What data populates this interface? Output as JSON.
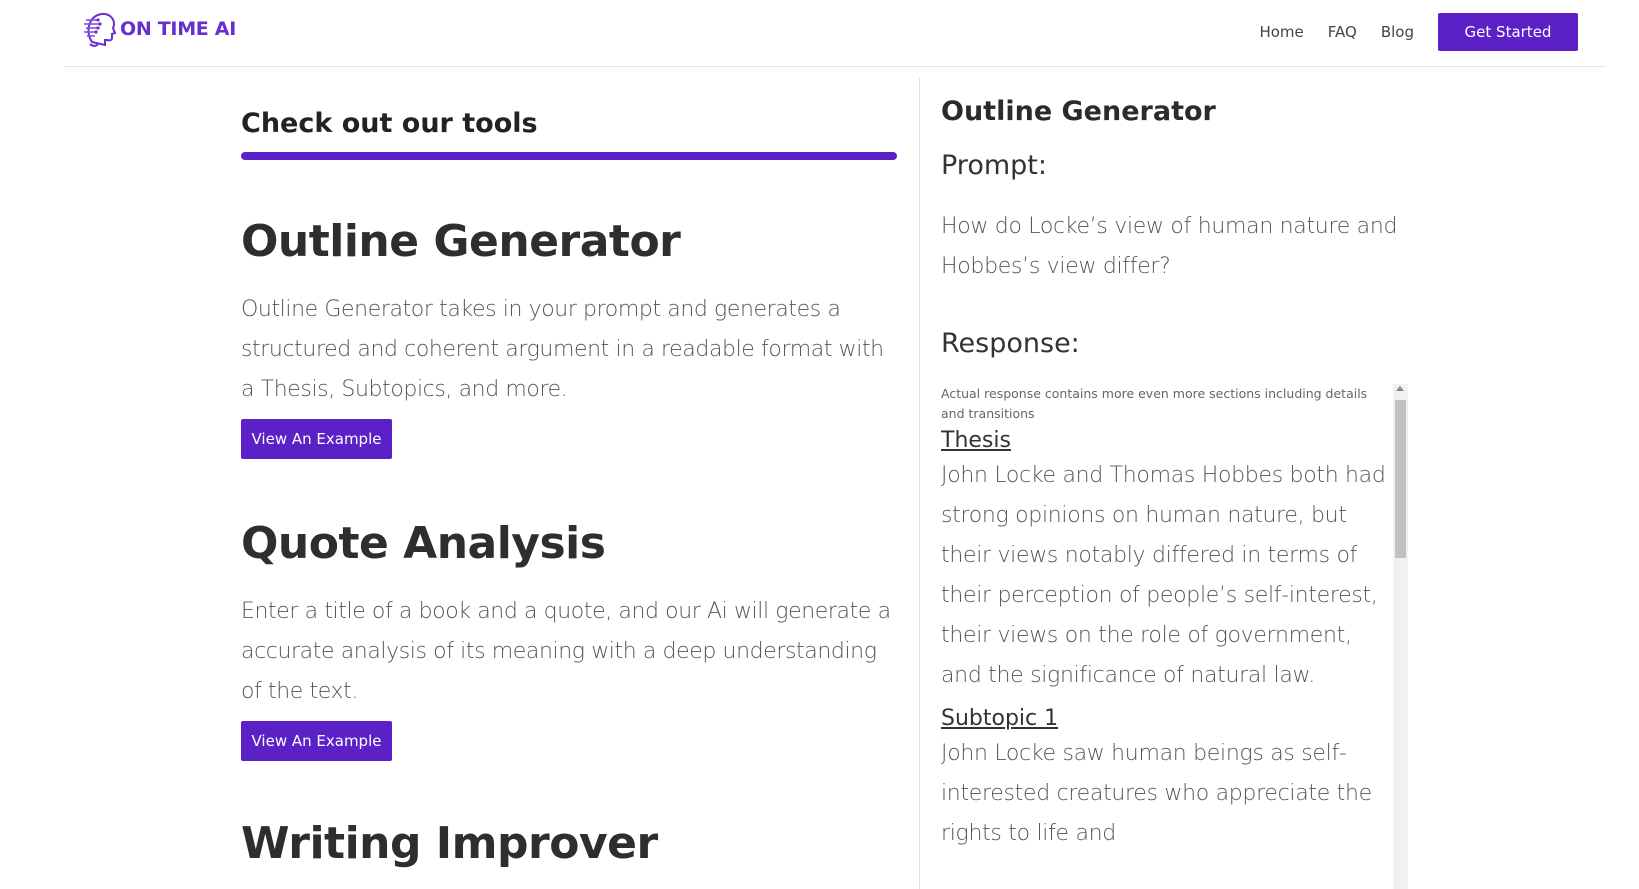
{
  "header": {
    "brand": "ON TIME AI",
    "nav": [
      "Home",
      "FAQ",
      "Blog"
    ],
    "cta_label": "Get Started",
    "accent_color": "#5b21c6"
  },
  "tools": {
    "heading": "Check out our tools",
    "items": [
      {
        "title": "Outline Generator",
        "description": "Outline Generator takes in your prompt and generates a structured and coherent argument in a readable format with a Thesis, Subtopics, and more.",
        "button_label": "View An Example"
      },
      {
        "title": "Quote Analysis",
        "description": "Enter a title of a book and a quote, and our Ai will generate a accurate analysis of its meaning with a deep understanding of the text.",
        "button_label": "View An Example"
      },
      {
        "title": "Writing Improver"
      }
    ]
  },
  "example": {
    "title": "Outline Generator",
    "prompt_label": "Prompt:",
    "prompt_text": "How do Locke’s view of human nature and Hobbes’s view differ?",
    "response_label": "Response:",
    "response_note": "Actual response contains more even more sections including details and transitions",
    "sections": [
      {
        "heading": "Thesis",
        "text": "John Locke and Thomas Hobbes both had strong opinions on human nature, but their views notably differed in terms of their perception of people’s self-interest, their views on the role of government, and the significance of natural law."
      },
      {
        "heading": "Subtopic 1",
        "text": "John Locke saw human beings as self-interested creatures who appreciate the rights to life and"
      }
    ]
  }
}
